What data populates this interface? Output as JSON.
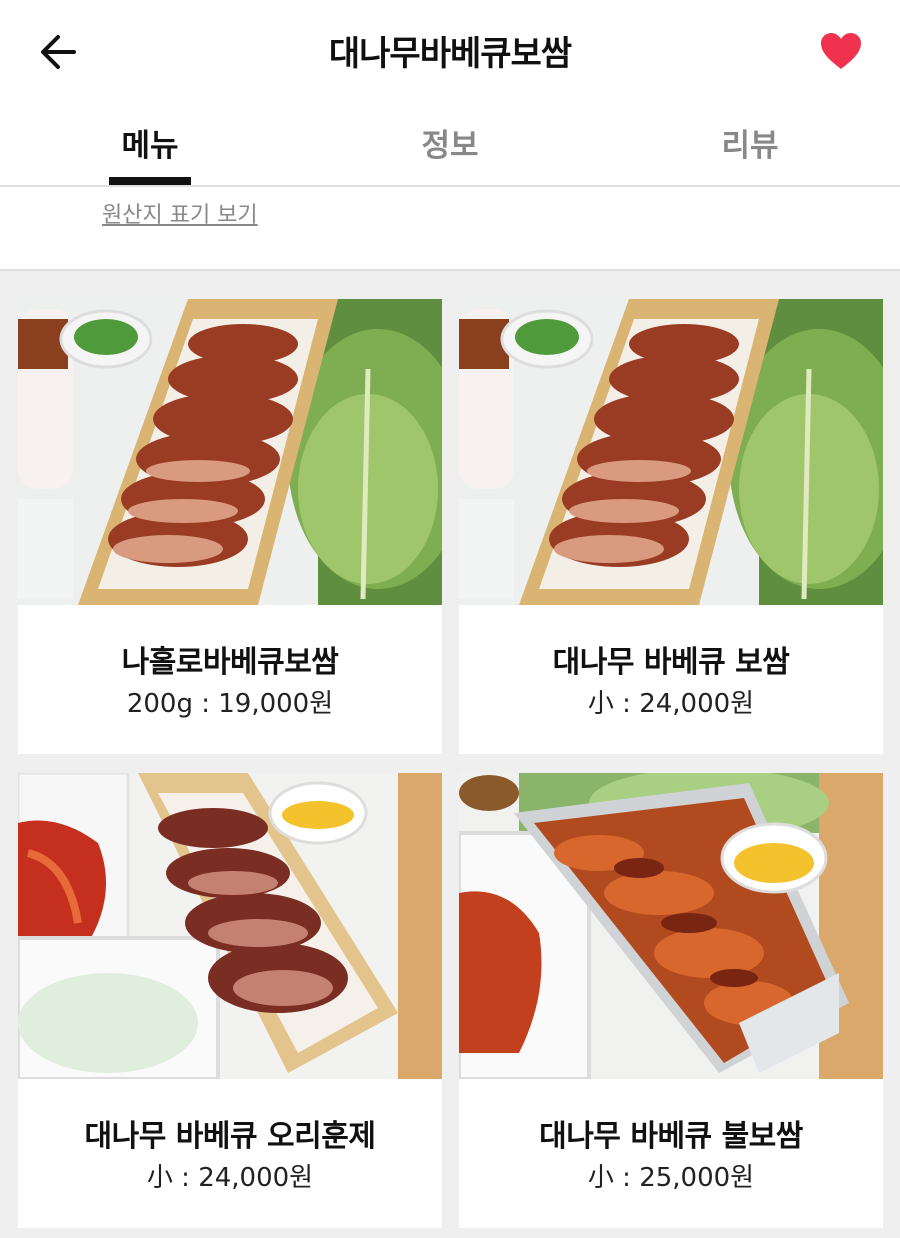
{
  "header": {
    "title": "대나무바베큐보쌈",
    "back_icon": "arrow-left-icon",
    "favorite_icon": "heart-icon",
    "favorite_color": "#f0324e"
  },
  "tabs": [
    {
      "label": "메뉴",
      "active": true
    },
    {
      "label": "정보",
      "active": false
    },
    {
      "label": "리뷰",
      "active": false
    }
  ],
  "origin_link": "원산지 표기 보기",
  "menu": [
    {
      "name": "나홀로바베큐보쌈",
      "price": "200g : 19,000원",
      "photo": "bossam-platter"
    },
    {
      "name": "대나무 바베큐 보쌈",
      "price": "小 : 24,000원",
      "photo": "bossam-platter"
    },
    {
      "name": "대나무 바베큐 오리훈제",
      "price": "小 : 24,000원",
      "photo": "smoked-duck"
    },
    {
      "name": "대나무 바베큐 불보쌈",
      "price": "小 : 25,000원",
      "photo": "spicy-bossam"
    }
  ]
}
